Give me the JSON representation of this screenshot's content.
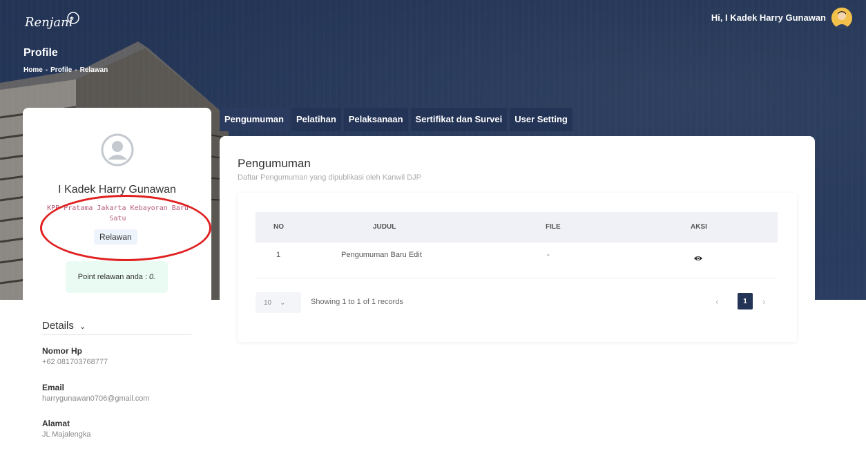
{
  "header": {
    "logo_text": "Renjani",
    "greeting": "Hi, I Kadek Harry Gunawan",
    "page_title": "Profile",
    "breadcrumb": [
      "Home",
      "-",
      "Profile",
      "-",
      "Relawan"
    ]
  },
  "profile": {
    "name": "I Kadek Harry Gunawan",
    "office": "KPP Pratama Jakarta Kebayoran Baru Satu",
    "role": "Relawan",
    "point_label": "Point relawan anda :",
    "point_value": "0."
  },
  "details": {
    "title": "Details",
    "fields": [
      {
        "label": "Nomor Hp",
        "value": "+62 081703768777"
      },
      {
        "label": "Email",
        "value": "harrygunawan0706@gmail.com"
      },
      {
        "label": "Alamat",
        "value": "JL Majalengka"
      }
    ]
  },
  "tabs": [
    "Pengumuman",
    "Pelatihan",
    "Pelaksanaan",
    "Sertifikat dan Survei",
    "User Setting"
  ],
  "main": {
    "title": "Pengumuman",
    "subtitle": "Daftar Pengumuman yang dipublikasi oleh Kanwil DJP",
    "table": {
      "columns": [
        "NO",
        "JUDUL",
        "FILE",
        "AKSI"
      ],
      "rows": [
        {
          "no": "1",
          "judul": "Pengumuman Baru Edit",
          "file": "-",
          "aksi": "eye-icon"
        }
      ]
    },
    "per_page": "10",
    "records_text": "Showing 1 to 1 of 1 records",
    "pagination": {
      "prev": "‹",
      "current": "1",
      "next": "›"
    }
  },
  "colors": {
    "navy": "#243456",
    "annotation_red": "#e02020",
    "point_bg": "#e9fbf2"
  }
}
